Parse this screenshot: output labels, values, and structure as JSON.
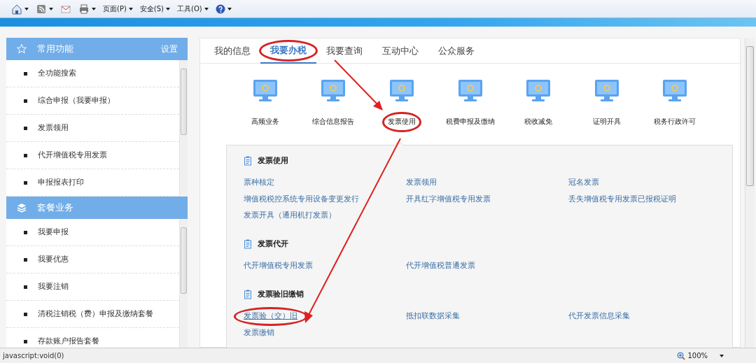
{
  "toolbar": {
    "menus": [
      "页面(P)",
      "安全(S)",
      "工具(O)"
    ]
  },
  "sidebar": {
    "panels": [
      {
        "kind": "star",
        "title": "常用功能",
        "action": "设置",
        "items": [
          "全功能搜索",
          "综合申报（我要申报）",
          "发票领用",
          "代开增值税专用发票",
          "申报报表打印"
        ]
      },
      {
        "kind": "layers",
        "title": "套餐业务",
        "items": [
          "我要申报",
          "我要优惠",
          "我要注销",
          "清税注销税（费）申报及缴纳套餐",
          "存款账户报告套餐"
        ]
      }
    ]
  },
  "tabs": [
    {
      "label": "我的信息",
      "selected": false,
      "circled": false
    },
    {
      "label": "我要办税",
      "selected": true,
      "circled": true
    },
    {
      "label": "我要查询",
      "selected": false,
      "circled": false
    },
    {
      "label": "互动中心",
      "selected": false,
      "circled": false
    },
    {
      "label": "公众服务",
      "selected": false,
      "circled": false
    }
  ],
  "services": [
    {
      "label": "高频业务",
      "circled": false
    },
    {
      "label": "综合信息报告",
      "circled": false
    },
    {
      "label": "发票使用",
      "circled": true
    },
    {
      "label": "税费申报及缴纳",
      "circled": false
    },
    {
      "label": "税收减免",
      "circled": false
    },
    {
      "label": "证明开具",
      "circled": false
    },
    {
      "label": "税务行政许可",
      "circled": false
    }
  ],
  "sections": [
    {
      "title": "发票使用",
      "links": [
        {
          "label": "票种核定",
          "hovered": false,
          "circled": false
        },
        {
          "label": "发票领用",
          "hovered": false,
          "circled": false
        },
        {
          "label": "冠名发票",
          "hovered": false,
          "circled": false
        },
        {
          "label": "增值税税控系统专用设备变更发行",
          "hovered": false,
          "circled": false
        },
        {
          "label": "开具红字增值税专用发票",
          "hovered": false,
          "circled": false
        },
        {
          "label": "丢失增值税专用发票已报税证明",
          "hovered": false,
          "circled": false
        },
        {
          "label": "发票开具（通用机打发票）",
          "hovered": false,
          "circled": false
        }
      ]
    },
    {
      "title": "发票代开",
      "links": [
        {
          "label": "代开增值税专用发票",
          "hovered": false,
          "circled": false
        },
        {
          "label": "代开增值税普通发票",
          "hovered": false,
          "circled": false
        }
      ]
    },
    {
      "title": "发票验旧缴销",
      "links": [
        {
          "label": "发票验（交）旧",
          "hovered": true,
          "circled": true
        },
        {
          "label": "抵扣联数据采集",
          "hovered": false,
          "circled": false
        },
        {
          "label": "代开发票信息采集",
          "hovered": false,
          "circled": false
        },
        {
          "label": "发票缴销",
          "hovered": false,
          "circled": false
        }
      ]
    }
  ],
  "status_bar": {
    "text": "javascript:void(0)",
    "zoom": "100%"
  }
}
